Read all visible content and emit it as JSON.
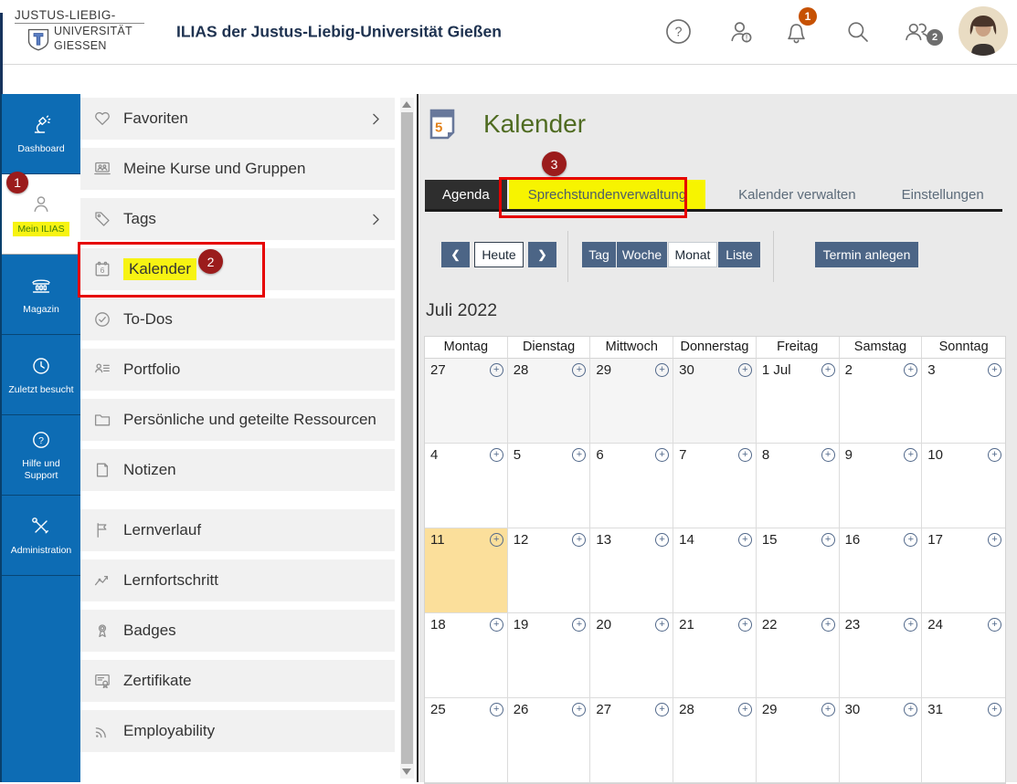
{
  "header": {
    "logo_line1": "JUSTUS-LIEBIG-",
    "logo_line2": "UNIVERSITÄT",
    "logo_line3": "GIESSEN",
    "title": "ILIAS der Justus-Liebig-Universität Gießen",
    "notification_badge": "1",
    "online_badge": "2"
  },
  "sidebar": {
    "items": [
      {
        "label": "Dashboard",
        "icon": "lamp"
      },
      {
        "label": "Mein ILIAS",
        "icon": "person",
        "active": true,
        "highlighted": true
      },
      {
        "label": "Magazin",
        "icon": "bank"
      },
      {
        "label": "Zuletzt besucht",
        "icon": "clock"
      },
      {
        "label": "Hilfe und Support",
        "icon": "help"
      },
      {
        "label": "Administration",
        "icon": "tools"
      }
    ]
  },
  "menu": {
    "items": [
      {
        "label": "Favoriten",
        "icon": "heart",
        "chevron": true
      },
      {
        "label": "Meine Kurse und Gruppen",
        "icon": "courses"
      },
      {
        "label": "Tags",
        "icon": "tag",
        "chevron": true
      },
      {
        "label": "Kalender",
        "icon": "calendar",
        "highlighted": true
      },
      {
        "label": "To-Dos",
        "icon": "check-circle"
      },
      {
        "label": "Portfolio",
        "icon": "portfolio"
      },
      {
        "label": "Persönliche und geteilte Ressourcen",
        "icon": "folder"
      },
      {
        "label": "Notizen",
        "icon": "note"
      },
      {
        "label": "Lernverlauf",
        "icon": "flag",
        "gap_before": true
      },
      {
        "label": "Lernfortschritt",
        "icon": "chart"
      },
      {
        "label": "Badges",
        "icon": "medal"
      },
      {
        "label": "Zertifikate",
        "icon": "certificate"
      },
      {
        "label": "Employability",
        "icon": "rss"
      }
    ]
  },
  "main": {
    "page_title": "Kalender",
    "tabs": [
      {
        "label": "Agenda",
        "state": "active"
      },
      {
        "label": "Sprechstundenverwaltung",
        "state": "highlighted"
      },
      {
        "label": "Kalender verwalten",
        "state": "normal"
      },
      {
        "label": "Einstellungen",
        "state": "normal"
      }
    ],
    "toolbar": {
      "prev_label": "❮",
      "today_label": "Heute",
      "next_label": "❯",
      "views": [
        "Tag",
        "Woche",
        "Monat",
        "Liste"
      ],
      "active_view": "Monat",
      "create_label": "Termin anlegen"
    },
    "calendar": {
      "month_title": "Juli 2022",
      "day_headers": [
        "Montag",
        "Dienstag",
        "Mittwoch",
        "Donnerstag",
        "Freitag",
        "Samstag",
        "Sonntag"
      ],
      "weeks": [
        [
          {
            "label": "27",
            "out": true
          },
          {
            "label": "28",
            "out": true
          },
          {
            "label": "29",
            "out": true
          },
          {
            "label": "30",
            "out": true
          },
          {
            "label": "1 Jul"
          },
          {
            "label": "2"
          },
          {
            "label": "3"
          }
        ],
        [
          {
            "label": "4"
          },
          {
            "label": "5"
          },
          {
            "label": "6"
          },
          {
            "label": "7"
          },
          {
            "label": "8"
          },
          {
            "label": "9"
          },
          {
            "label": "10"
          }
        ],
        [
          {
            "label": "11",
            "today": true
          },
          {
            "label": "12"
          },
          {
            "label": "13"
          },
          {
            "label": "14"
          },
          {
            "label": "15"
          },
          {
            "label": "16"
          },
          {
            "label": "17"
          }
        ],
        [
          {
            "label": "18"
          },
          {
            "label": "19"
          },
          {
            "label": "20"
          },
          {
            "label": "21"
          },
          {
            "label": "22"
          },
          {
            "label": "23"
          },
          {
            "label": "24"
          }
        ],
        [
          {
            "label": "25"
          },
          {
            "label": "26"
          },
          {
            "label": "27"
          },
          {
            "label": "28"
          },
          {
            "label": "29"
          },
          {
            "label": "30"
          },
          {
            "label": "31"
          }
        ]
      ]
    }
  },
  "annotations": {
    "step1": "1",
    "step2": "2",
    "step3": "3"
  },
  "colors": {
    "sidebar_blue": "#0d6cb4",
    "annotation_red": "#9b1c1c",
    "box_red": "#e60000",
    "highlight_yellow": "#f7f312",
    "today_yellow": "#fbdf9b",
    "button_slate": "#4c6586",
    "title_green": "#4f6b21",
    "bell_badge_orange": "#c65102",
    "online_badge_gray": "#6e6e6e"
  }
}
